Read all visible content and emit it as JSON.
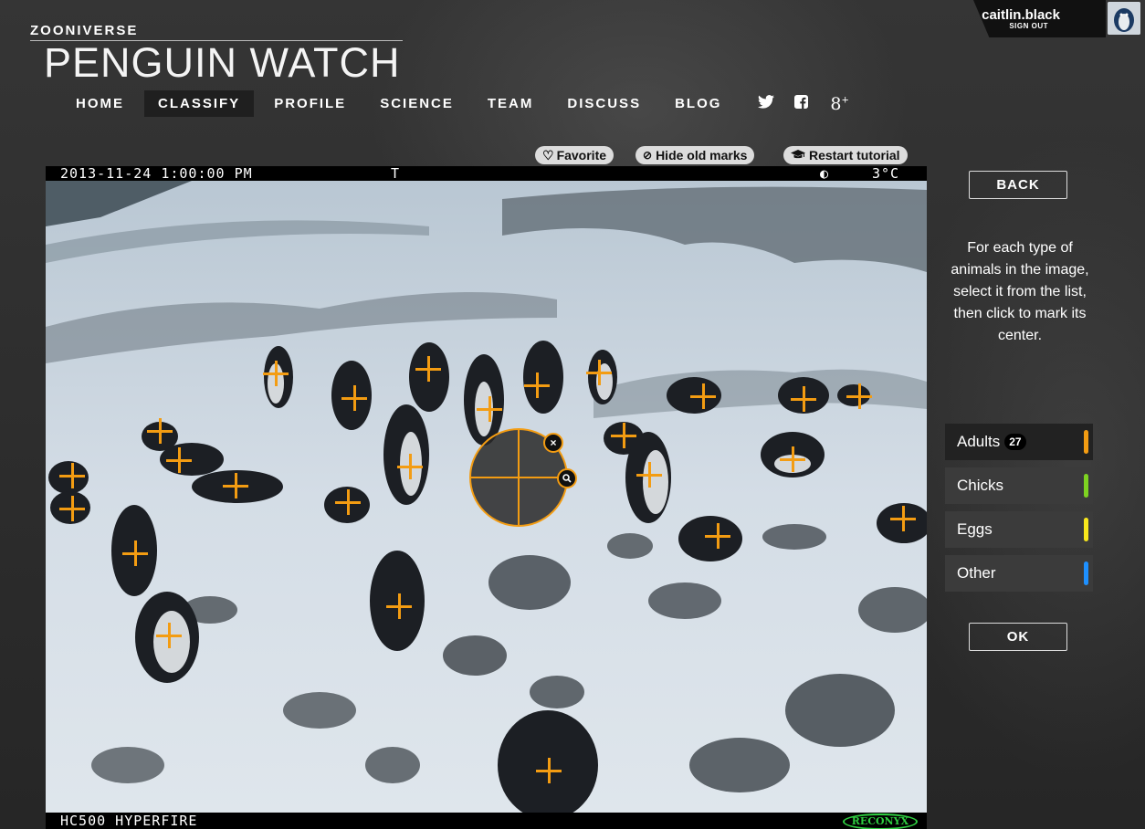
{
  "header": {
    "brand": "ZOONIVERSE",
    "title": "PENGUIN WATCH",
    "nav": [
      {
        "label": "HOME"
      },
      {
        "label": "CLASSIFY",
        "active": true
      },
      {
        "label": "PROFILE"
      },
      {
        "label": "SCIENCE"
      },
      {
        "label": "TEAM"
      },
      {
        "label": "DISCUSS"
      },
      {
        "label": "BLOG"
      }
    ],
    "social": [
      "twitter-icon",
      "facebook-icon",
      "google-plus-icon"
    ]
  },
  "user": {
    "name": "caitlin.black",
    "sign_out": "SIGN OUT"
  },
  "toolbar": {
    "favorite": "Favorite",
    "hide_marks": "Hide old marks",
    "restart": "Restart tutorial"
  },
  "camera": {
    "timestamp": "2013-11-24 1:00:00 PM",
    "flag": "T",
    "temperature": "3°C",
    "model": "HC500 HYPERFIRE",
    "brand_logo": "RECONYX"
  },
  "panel": {
    "back": "BACK",
    "instructions": "For each type of animals in the image, select it from the list, then click to mark its center.",
    "types": [
      {
        "label": "Adults",
        "count": "27",
        "color": "#f39c12",
        "active": true
      },
      {
        "label": "Chicks",
        "color": "#7ed321"
      },
      {
        "label": "Eggs",
        "color": "#f8e71c"
      },
      {
        "label": "Other",
        "color": "#1e90ff"
      }
    ],
    "ok": "OK"
  },
  "colors": {
    "mark": "#f39c12",
    "background": "#2b2b2b"
  }
}
